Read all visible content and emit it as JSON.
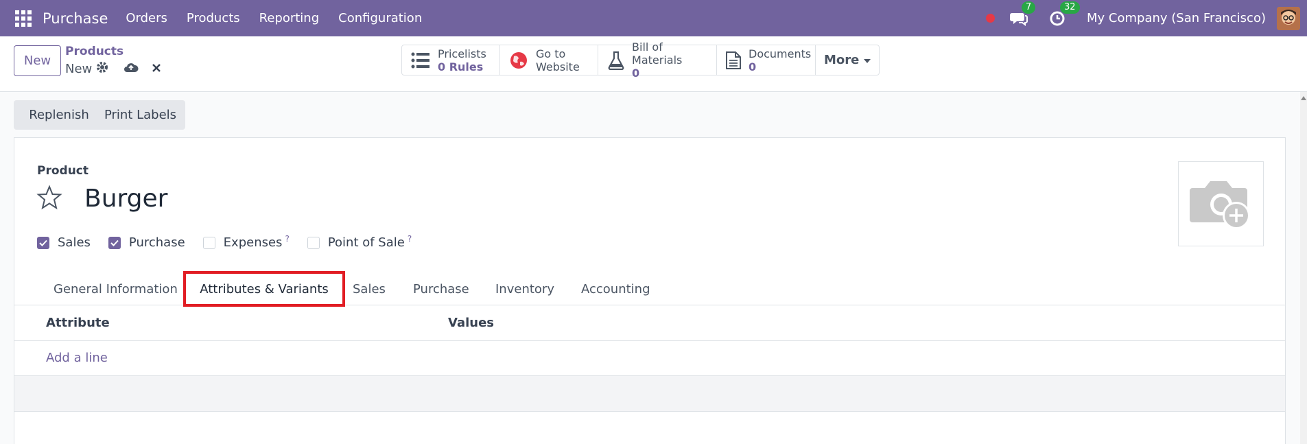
{
  "navbar": {
    "brand": "Purchase",
    "menu": [
      "Orders",
      "Products",
      "Reporting",
      "Configuration"
    ],
    "messages_count": "7",
    "activities_count": "32",
    "company": "My Company (San Francisco)"
  },
  "control": {
    "new_label": "New",
    "breadcrumb_parent": "Products",
    "breadcrumb_current": "New",
    "smart_buttons": {
      "pricelists": {
        "title": "Pricelists",
        "value": "0 Rules"
      },
      "website": {
        "line1": "Go to",
        "line2": "Website"
      },
      "bom": {
        "title": "Bill of Materials",
        "value": "0"
      },
      "documents": {
        "title": "Documents",
        "value": "0"
      },
      "more": "More"
    }
  },
  "actions": {
    "replenish": "Replenish",
    "print_labels": "Print Labels"
  },
  "form": {
    "product_label": "Product",
    "product_name": "Burger",
    "checkboxes": [
      {
        "label": "Sales",
        "checked": true
      },
      {
        "label": "Purchase",
        "checked": true
      },
      {
        "label": "Expenses",
        "checked": false,
        "help": "?"
      },
      {
        "label": "Point of Sale",
        "checked": false,
        "help": "?"
      }
    ],
    "tabs": [
      "General Information",
      "Attributes & Variants",
      "Sales",
      "Purchase",
      "Inventory",
      "Accounting"
    ],
    "active_tab": "Attributes & Variants",
    "table": {
      "columns": [
        "Attribute",
        "Values"
      ],
      "add_line": "Add a line"
    }
  },
  "colors": {
    "brand": "#71639e",
    "highlight": "#e11d24",
    "badge": "#28a745"
  }
}
